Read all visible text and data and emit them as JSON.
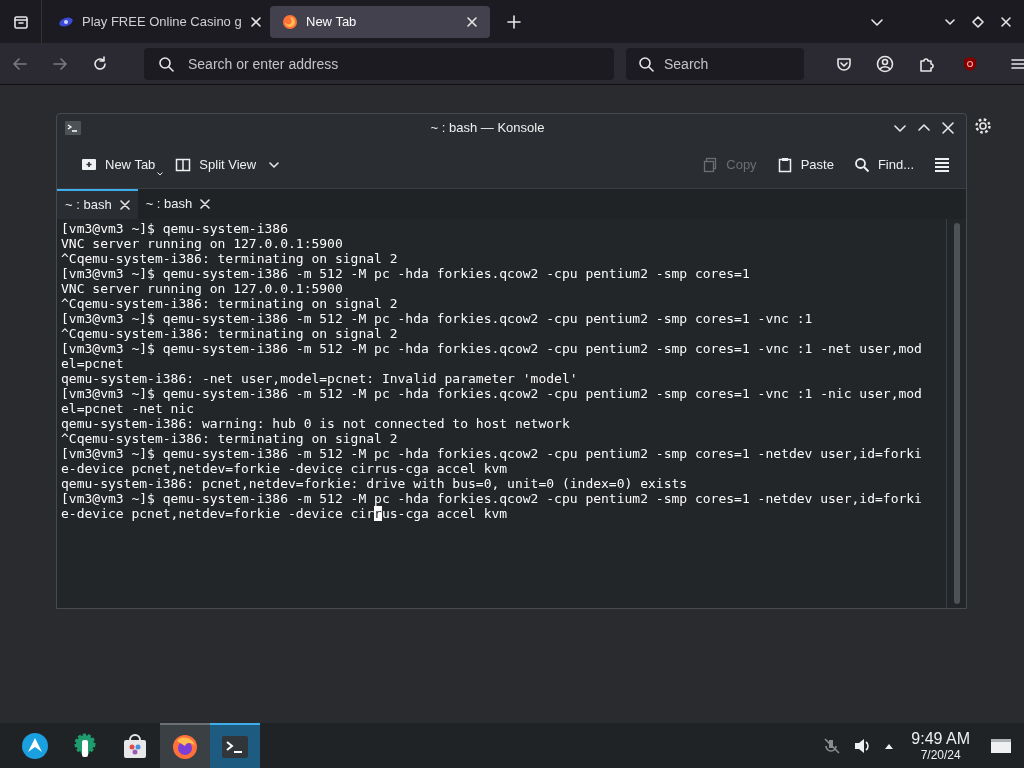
{
  "browser": {
    "tabs": [
      {
        "title": "Play FREE Online Casino g",
        "selected": false,
        "kind": "site"
      },
      {
        "title": "New Tab",
        "selected": true,
        "kind": "firefox"
      }
    ],
    "address": {
      "placeholder": "Search or enter address"
    },
    "search": {
      "placeholder": "Search"
    }
  },
  "konsole": {
    "title": "~ : bash — Konsole",
    "toolbar": [
      {
        "label": "New Tab",
        "kind": "newtab",
        "disabled": false
      },
      {
        "label": "Split View",
        "kind": "split",
        "disabled": false
      },
      {
        "label": "Copy",
        "kind": "copy",
        "disabled": true
      },
      {
        "label": "Paste",
        "kind": "paste",
        "disabled": false
      },
      {
        "label": "Find...",
        "kind": "find",
        "disabled": false
      }
    ],
    "tabs": [
      {
        "label": "~ : bash",
        "selected": true
      },
      {
        "label": "~ : bash",
        "selected": false
      }
    ],
    "lines": [
      {
        "text": "[vm3@vm3 ~]$ qemu-system-i386"
      },
      {
        "text": "VNC server running on 127.0.0.1:5900"
      },
      {
        "text": "^Cqemu-system-i386: terminating on signal 2"
      },
      {
        "text": "[vm3@vm3 ~]$ qemu-system-i386 -m 512 -M pc -hda forkies.qcow2 -cpu pentium2 -smp cores=1"
      },
      {
        "text": "VNC server running on 127.0.0.1:5900"
      },
      {
        "text": "^Cqemu-system-i386: terminating on signal 2"
      },
      {
        "text": "[vm3@vm3 ~]$ qemu-system-i386 -m 512 -M pc -hda forkies.qcow2 -cpu pentium2 -smp cores=1 -vnc :1"
      },
      {
        "text": "^Cqemu-system-i386: terminating on signal 2"
      },
      {
        "text": "[vm3@vm3 ~]$ qemu-system-i386 -m 512 -M pc -hda forkies.qcow2 -cpu pentium2 -smp cores=1 -vnc :1 -net user,mod"
      },
      {
        "text": "el=pcnet"
      },
      {
        "text": "qemu-system-i386: -net user,model=pcnet: Invalid parameter 'model'"
      },
      {
        "text": "[vm3@vm3 ~]$ qemu-system-i386 -m 512 -M pc -hda forkies.qcow2 -cpu pentium2 -smp cores=1 -vnc :1 -nic user,mod"
      },
      {
        "text": "el=pcnet -net nic"
      },
      {
        "text": "qemu-system-i386: warning: hub 0 is not connected to host network"
      },
      {
        "text": "^Cqemu-system-i386: terminating on signal 2"
      },
      {
        "text": "[vm3@vm3 ~]$ qemu-system-i386 -m 512 -M pc -hda forkies.qcow2 -cpu pentium2 -smp cores=1 -netdev user,id=forki"
      },
      {
        "text": "e-device pcnet,netdev=forkie -device cirrus-cga accel kvm"
      },
      {
        "text": "qemu-system-i386: pcnet,netdev=forkie: drive with bus=0, unit=0 (index=0) exists"
      },
      {
        "text": "[vm3@vm3 ~]$ qemu-system-i386 -m 512 -M pc -hda forkies.qcow2 -cpu pentium2 -smp cores=1 -netdev user,id=forki"
      },
      {
        "text": "e-device pcnet,netdev=forkie -device cir",
        "cursor": "r",
        "after": "us-cga accel kvm"
      }
    ]
  },
  "taskbar": {
    "apps": [
      {
        "kind": "launcher",
        "active": false
      },
      {
        "kind": "settings",
        "active": false
      },
      {
        "kind": "store",
        "active": false
      },
      {
        "kind": "firefox",
        "active": true
      },
      {
        "kind": "terminal",
        "active": true
      }
    ],
    "time": "9:49 AM",
    "date": "7/20/24"
  }
}
